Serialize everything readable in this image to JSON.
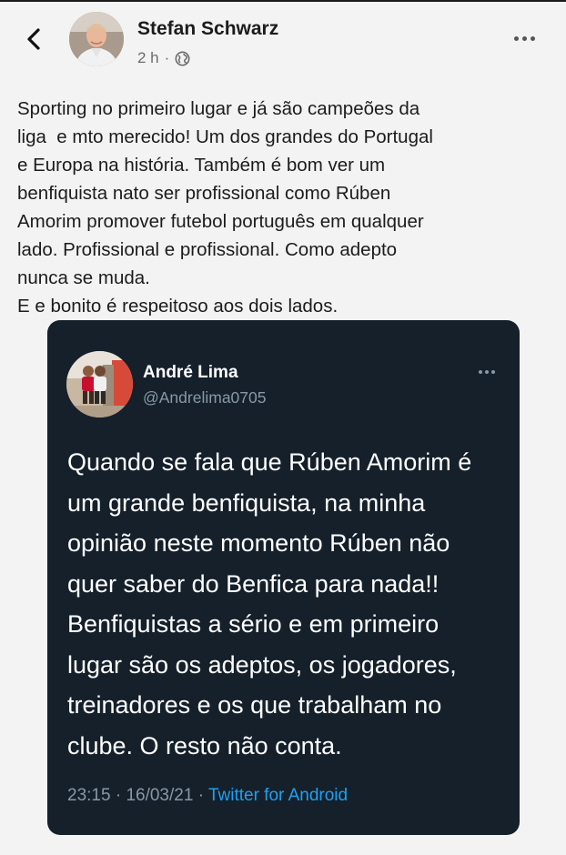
{
  "post": {
    "author_name": "Stefan Schwarz",
    "timestamp": "2 h",
    "separator": "·",
    "privacy_icon": "globe-icon",
    "back_icon": "chevron-left-icon",
    "more_icon": "more-horizontal-icon",
    "body_lines": [
      "Sporting no primeiro lugar e já são campeões da",
      "liga  e mto merecido! Um dos grandes do Portugal",
      "e Europa na história. Também é bom ver um",
      "benfiquista nato ser profissional como Rúben",
      "Amorim promover futebol português em qualquer",
      "lado. Profissional e profissional. Como adepto",
      "nunca se muda.",
      "E e bonito é respeitoso aos dois lados."
    ]
  },
  "tweet": {
    "name": "André Lima",
    "handle": "@Andrelima0705",
    "text_lines": [
      "Quando se fala que Rúben Amorim é",
      "um grande benfiquista, na minha",
      "opinião neste momento Rúben não",
      "quer saber do Benfica para nada!!",
      "Benfiquistas a sério e em primeiro",
      "lugar são os adeptos, os jogadores,",
      "treinadores e os que trabalham no",
      "clube. O resto não conta."
    ],
    "time": "23:15",
    "date": "16/03/21",
    "separator": "·",
    "source": "Twitter for Android",
    "more_icon": "more-horizontal-icon"
  },
  "colors": {
    "page_bg": "#f3f3f3",
    "tweet_bg": "#15202b",
    "tweet_secondary": "#8899a6",
    "link_blue": "#1da1f2"
  }
}
